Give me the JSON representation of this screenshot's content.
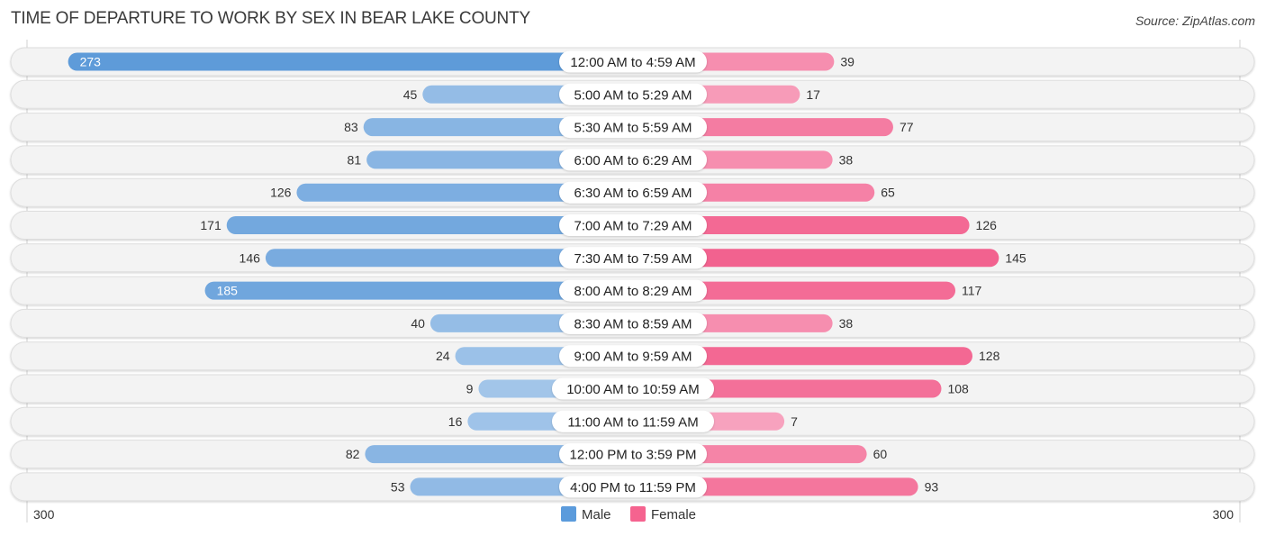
{
  "header": {
    "title": "TIME OF DEPARTURE TO WORK BY SEX IN BEAR LAKE COUNTY",
    "source": "Source: ZipAtlas.com"
  },
  "colors": {
    "male_strong": "#5e9bd9",
    "male_light": "#a9c9eb",
    "female_strong": "#f2628f",
    "female_light": "#f8abc4",
    "row_bg": "#f3f3f3",
    "legend_male": "#5b9bdc",
    "legend_female": "#f5638f"
  },
  "chart_data": {
    "type": "bar",
    "orientation": "horizontal-diverging",
    "title": "TIME OF DEPARTURE TO WORK BY SEX IN BEAR LAKE COUNTY",
    "categories": [
      "12:00 AM to 4:59 AM",
      "5:00 AM to 5:29 AM",
      "5:30 AM to 5:59 AM",
      "6:00 AM to 6:29 AM",
      "6:30 AM to 6:59 AM",
      "7:00 AM to 7:29 AM",
      "7:30 AM to 7:59 AM",
      "8:00 AM to 8:29 AM",
      "8:30 AM to 8:59 AM",
      "9:00 AM to 9:59 AM",
      "10:00 AM to 10:59 AM",
      "11:00 AM to 11:59 AM",
      "12:00 PM to 3:59 PM",
      "4:00 PM to 11:59 PM"
    ],
    "series": [
      {
        "name": "Male",
        "side": "left",
        "values": [
          273,
          45,
          83,
          81,
          126,
          171,
          146,
          185,
          40,
          24,
          9,
          16,
          82,
          53
        ]
      },
      {
        "name": "Female",
        "side": "right",
        "values": [
          39,
          17,
          77,
          38,
          65,
          126,
          145,
          117,
          38,
          128,
          108,
          7,
          60,
          93
        ]
      }
    ],
    "axis": {
      "left_tick": "300",
      "right_tick": "300",
      "range": [
        0,
        300
      ]
    },
    "legend": {
      "position": "bottom-center",
      "entries": [
        "Male",
        "Female"
      ]
    },
    "grid": false
  }
}
